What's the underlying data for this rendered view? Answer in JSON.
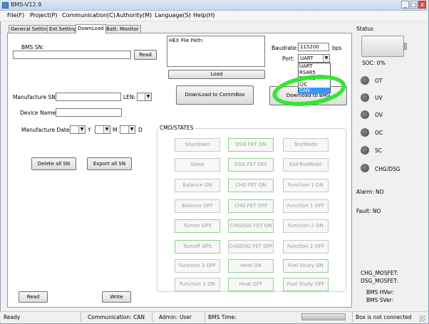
{
  "window": {
    "title": "BMS-V12.9",
    "minimize": "_",
    "maximize": "□",
    "close": "x"
  },
  "menu": [
    "File(F)",
    "Project(P)",
    "Communication(C)",
    "Authority(M)",
    "Language(S)",
    "Help(H)"
  ],
  "tabs": [
    "General Setting",
    "Ext.Setting",
    "DownLoad",
    "Batt. Monitor"
  ],
  "left": {
    "bms_sn_label": "BMS SN:",
    "bms_sn_value": "",
    "read_btn": "Read",
    "manufacture_sn_label": "Manufacture SN:",
    "len_label": "LEN:",
    "device_name_label": "Device Name:",
    "manufacture_date_label": "Manufacture Date:",
    "y_label": "Y",
    "m_label": "M",
    "d_label": "D",
    "delete_all_btn": "Delete all SN",
    "export_all_btn": "Export all SN",
    "read_bottom_btn": "Read",
    "write_btn": "Write"
  },
  "download": {
    "hex_label": "HEX File Path:",
    "load_btn": "Load",
    "download_commbox_btn": "DownLoad to CommBox",
    "download_bms_btn": "Download to BMS",
    "baudrate_label": "Baudrate:",
    "baudrate_value": "115200",
    "bps_label": "bps",
    "port_label": "Port:",
    "port_value": "UART",
    "port_options": [
      "UART",
      "RS485",
      "RS232",
      "I2C",
      "CAN"
    ],
    "port_highlight": "CAN"
  },
  "cmd": {
    "title": "CMD/STATES",
    "rows": [
      [
        "Shutdown",
        "DSG FET ON",
        "TestMode"
      ],
      [
        "Sleep",
        "DSG FET OFF",
        "ExitTestMode"
      ],
      [
        "Balance ON",
        "CHG FET ON",
        "Function 1 ON"
      ],
      [
        "Balance OFF",
        "CHG FET OFF",
        "Function 1 OFF"
      ],
      [
        "Turnon GPS",
        "CHGDSG FET ON",
        "Function 2 ON"
      ],
      [
        "Turnoff GPS",
        "CHGDSG FET OFF",
        "Function 2 OFF"
      ],
      [
        "Function 3 OFF",
        "Heat ON",
        "Fuel Study ON"
      ],
      [
        "Function 3 ON",
        "Heat OFF",
        "Fuel Study OFF"
      ]
    ]
  },
  "status": {
    "title": "Status",
    "soc": "SOC:  0%",
    "indicators": [
      "OT",
      "UV",
      "OV",
      "OC",
      "SC",
      "CHG/DSG"
    ],
    "alarm": "Alarm:  NO",
    "fault": "Fault:  NO",
    "chg_mosfet": "CHG_MOSFET:",
    "dsg_mosfet": "DSG_MOSFET:",
    "hver": "BMS HVer:",
    "sver": "BMS SVer:"
  },
  "statusbar": {
    "ready": "Ready",
    "communication": "Communication:  CAN",
    "admin": "Admin:  User",
    "bms_time": "BMS Time:",
    "connection": "Box is not connected"
  }
}
